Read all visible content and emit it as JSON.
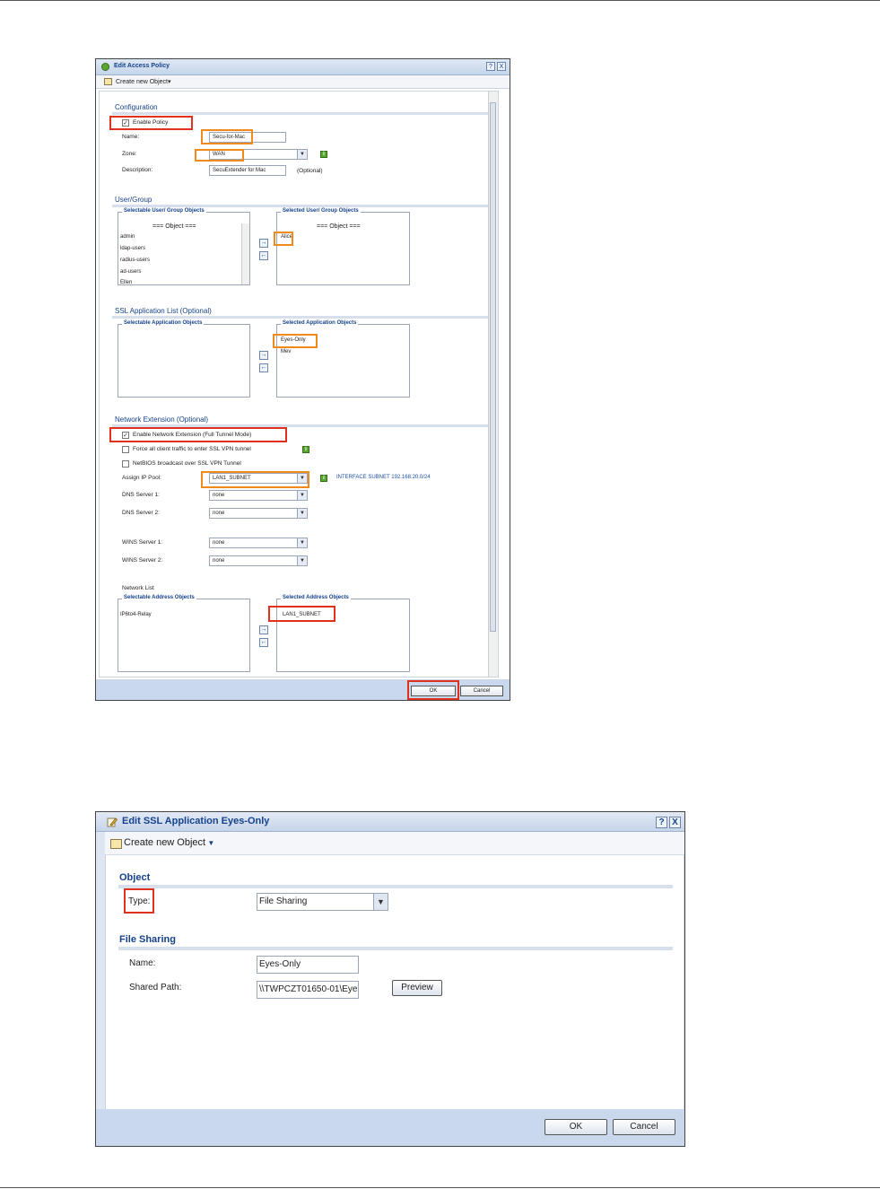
{
  "policy_dialog": {
    "title": "Edit Access Policy",
    "help_label": "?",
    "close_label": "X",
    "toolbar": {
      "create_label": "Create new Object"
    },
    "configuration": {
      "heading": "Configuration",
      "enable_policy_label": "Enable Policy",
      "enable_policy_checked": true,
      "name_label": "Name:",
      "name_value": "Secu-for-Mac",
      "zone_label": "Zone:",
      "zone_value": "WAN",
      "description_label": "Description:",
      "description_value": "SecuExtender for Mac",
      "description_hint": "(Optional)"
    },
    "user_group": {
      "heading": "User/Group",
      "selectable_legend": "Selectable User/ Group Objects",
      "selected_legend": "Selected User/ Group Objects",
      "selectable_header": "=== Object ===",
      "selected_header": "=== Object ===",
      "selectable_items": [
        "admin",
        "ldap-users",
        "radius-users",
        "ad-users",
        "Ellen"
      ],
      "selected_items": [
        "Alice"
      ]
    },
    "ssl_app": {
      "heading": "SSL Application List (Optional)",
      "selectable_legend": "Selectable Application Objects",
      "selected_legend": "Selected Application Objects",
      "selected_items": [
        "Eyes-Only",
        "Mev"
      ]
    },
    "network_ext": {
      "heading": "Network Extension (Optional)",
      "enable_label": "Enable Network Extension (Full Tunnel Mode)",
      "enable_checked": true,
      "force_label": "Force all client traffic to enter SSL VPN tunnel",
      "netbios_label": "NetBIOS broadcast over SSL VPN Tunnel",
      "pool_label": "Assign IP Pool:",
      "pool_value": "LAN1_SUBNET",
      "pool_info": "INTERFACE SUBNET 192.168.20.0/24",
      "dns1_label": "DNS Server 1:",
      "dns1_value": "none",
      "dns2_label": "DNS Server 2:",
      "dns2_value": "none",
      "wins1_label": "WINS Server 1:",
      "wins1_value": "none",
      "wins2_label": "WINS Server 2:",
      "wins2_value": "none",
      "network_list_label": "Network List",
      "selectable_legend": "Selectable Address Objects",
      "selected_legend": "Selected Address Objects",
      "selectable_items": [
        "IP6to4-Relay"
      ],
      "selected_items": [
        "LAN1_SUBNET"
      ]
    },
    "footer": {
      "ok_label": "OK",
      "cancel_label": "Cancel"
    }
  },
  "ssl_dialog": {
    "title": "Edit SSL Application Eyes-Only",
    "help_label": "?",
    "close_label": "X",
    "toolbar": {
      "create_label": "Create new Object"
    },
    "object": {
      "heading": "Object",
      "type_label": "Type:",
      "type_value": "File Sharing"
    },
    "file_sharing": {
      "heading": "File Sharing",
      "name_label": "Name:",
      "name_value": "Eyes-Only",
      "path_label": "Shared Path:",
      "path_value": "\\\\TWPCZT01650-01\\Eye",
      "preview_label": "Preview"
    },
    "footer": {
      "ok_label": "OK",
      "cancel_label": "Cancel"
    }
  },
  "colors": {
    "highlight_red": "#e0301e",
    "highlight_orange": "#ef8a1b",
    "section_blue": "#15428b"
  }
}
